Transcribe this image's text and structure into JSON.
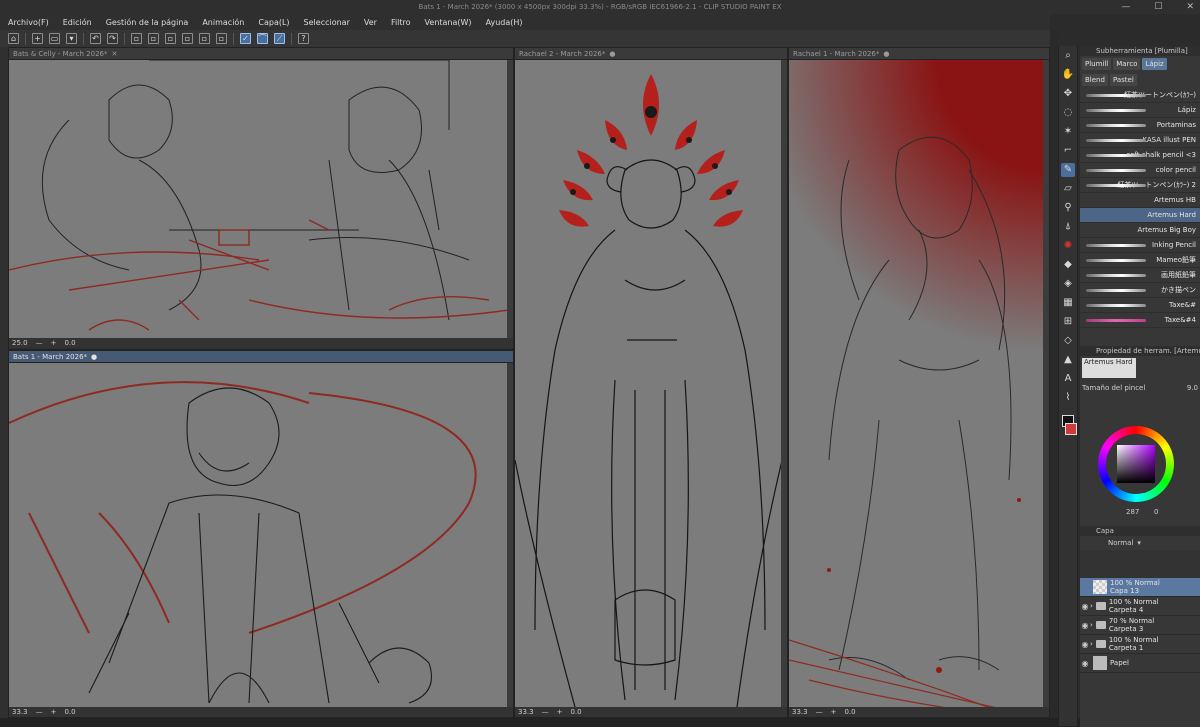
{
  "window": {
    "title": "Bats 1 - March 2026* (3000 x 4500px 300dpi 33.3%) - RGB/sRGB IEC61966-2.1 - CLIP STUDIO PAINT EX",
    "controls": [
      "—",
      "☐",
      "✕"
    ]
  },
  "menu": [
    "Archivo(F)",
    "Edición",
    "Gestión de la página",
    "Animación",
    "Capa(L)",
    "Seleccionar",
    "Ver",
    "Filtro",
    "Ventana(W)",
    "Ayuda(H)"
  ],
  "documents": [
    {
      "tab": "Bats & Celly - March 2026*",
      "zoom": "25.0",
      "angle": "0.0",
      "active": false
    },
    {
      "tab": "Bats 1 - March 2026*",
      "zoom": "33.3",
      "angle": "0.0",
      "active": true
    },
    {
      "tab": "Rachael 2 - March 2026*",
      "zoom": "33.3",
      "angle": "0.0",
      "active": false
    },
    {
      "tab": "Rachael 1 - March 2026*",
      "zoom": "33.3",
      "angle": "0.0",
      "active": false
    }
  ],
  "tools": [
    "zoom-icon",
    "hand-icon",
    "move-icon",
    "lasso-icon",
    "magic-wand-icon",
    "eyedropper-icon",
    "pen-icon",
    "eraser-icon",
    "brush-icon",
    "airbrush-icon",
    "decoration-icon",
    "blend-icon",
    "fill-icon",
    "gradient-icon",
    "frame-icon",
    "shape-icon",
    "balloon-icon",
    "text-icon",
    "correct-line-icon"
  ],
  "subtool": {
    "header": "Subherramienta [Plumilla]",
    "tabs": [
      "Plumill",
      "Marco",
      "Lápiz",
      "Blend",
      "Pastel"
    ],
    "selected_tab": "Lápiz",
    "brushes": [
      "紅茶ツートンペン(ｶﾗｰ)",
      "Lápiz",
      "Portaminas",
      "KASA illust PEN",
      "soft chalk pencil <3",
      "color pencil",
      "紅茶ツートンペン(ｶﾗｰ) 2",
      "Artemus HB",
      "Artemus Hard",
      "Artemus Big Boy",
      "Inking Pencil",
      "Mameo鉛筆",
      "画用紙鉛筆",
      "かき描ペン",
      "Taxe&#",
      "Taxe&#4"
    ],
    "selected_brush": "Artemus Hard"
  },
  "tool_property": {
    "header": "Propiedad de herram. [Artemus Hard]",
    "brush_name": "Artemus Hard",
    "size_label": "Tamaño del pincel",
    "size_value": "9.0"
  },
  "color": {
    "main": "#111111",
    "sub": "#cf3b3b",
    "hue_value": "287",
    "indicator": "0"
  },
  "layers": {
    "header": "Capa",
    "blend_mode": "Normal",
    "items": [
      {
        "mode": "100 % Normal",
        "name": "Capa 13",
        "type": "raster",
        "selected": true,
        "visible": false
      },
      {
        "mode": "100 % Normal",
        "name": "Carpeta 4",
        "type": "folder",
        "selected": false,
        "visible": true
      },
      {
        "mode": "70 % Normal",
        "name": "Carpeta 3",
        "type": "folder",
        "selected": false,
        "visible": true
      },
      {
        "mode": "100 % Normal",
        "name": "Carpeta 1",
        "type": "folder",
        "selected": false,
        "visible": true
      },
      {
        "mode": "",
        "name": "Papel",
        "type": "paper",
        "selected": false,
        "visible": true
      }
    ]
  }
}
